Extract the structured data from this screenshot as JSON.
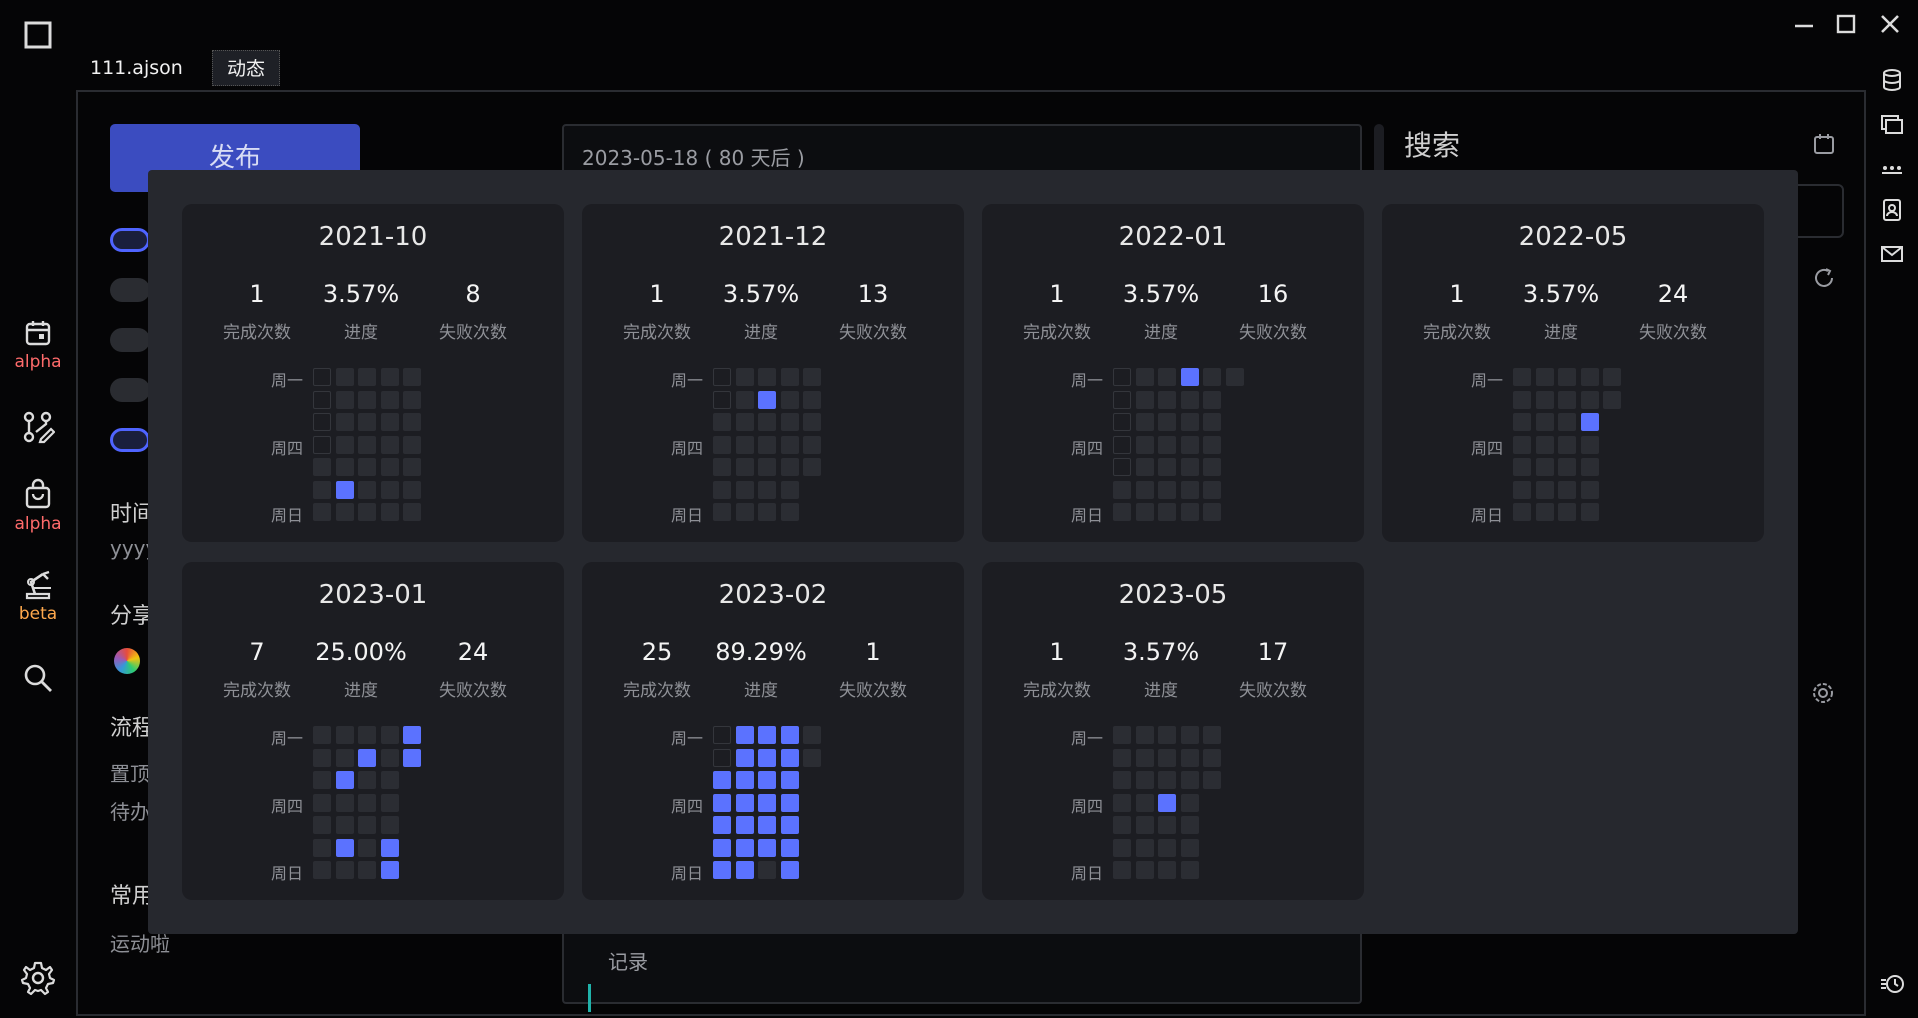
{
  "tabs": [
    {
      "label": "111.ajson",
      "active": false
    },
    {
      "label": "动态",
      "active": true
    }
  ],
  "left_rail": [
    {
      "icon": "calendar-icon",
      "label": "alpha",
      "color": "#ff6b6b"
    },
    {
      "icon": "git-edit-icon",
      "label": "",
      "color": ""
    },
    {
      "icon": "shopping-bag-icon",
      "label": "alpha",
      "color": "#ff6b6b"
    },
    {
      "icon": "robot-arm-icon",
      "label": "beta",
      "color": "#ffa94d"
    },
    {
      "icon": "search-icon",
      "label": "",
      "color": ""
    },
    {
      "icon": "gear-icon",
      "label": "",
      "color": ""
    }
  ],
  "background": {
    "publish_button": "发布",
    "date_field": "2023-05-18 ( 80 天后 )",
    "search_title": "搜索",
    "section_time": "时间",
    "time_format": "yyyy",
    "section_share": "分享",
    "section_flow": "流程",
    "flow_top": "置顶",
    "flow_todo": "待办",
    "section_common": "常用",
    "common_item": "运动啦",
    "record_text": "记录"
  },
  "accent": "#5b72ff",
  "weekday_labels": [
    "周一",
    "周四",
    "周日"
  ],
  "stat_labels": [
    "完成次数",
    "进度",
    "失败次数"
  ],
  "months": [
    {
      "title": "2021-10",
      "done": "1",
      "progress": "3.57%",
      "failed": "8",
      "grid": [
        [
          0,
          1,
          1,
          1,
          1
        ],
        [
          0,
          1,
          1,
          1,
          1
        ],
        [
          0,
          1,
          1,
          1,
          1
        ],
        [
          0,
          1,
          1,
          1,
          1
        ],
        [
          1,
          1,
          1,
          1,
          1
        ],
        [
          1,
          2,
          1,
          1,
          1
        ],
        [
          1,
          1,
          1,
          1,
          1
        ]
      ]
    },
    {
      "title": "2021-12",
      "done": "1",
      "progress": "3.57%",
      "failed": "13",
      "grid": [
        [
          0,
          1,
          1,
          1,
          1
        ],
        [
          0,
          1,
          2,
          1,
          1
        ],
        [
          1,
          1,
          1,
          1,
          1
        ],
        [
          1,
          1,
          1,
          1,
          1
        ],
        [
          1,
          1,
          1,
          1,
          1
        ],
        [
          1,
          1,
          1,
          1,
          -1
        ],
        [
          1,
          1,
          1,
          1,
          -1
        ]
      ]
    },
    {
      "title": "2022-01",
      "done": "1",
      "progress": "3.57%",
      "failed": "16",
      "grid": [
        [
          0,
          1,
          1,
          2,
          1,
          1
        ],
        [
          0,
          1,
          1,
          1,
          1,
          -1
        ],
        [
          0,
          1,
          1,
          1,
          1,
          -1
        ],
        [
          0,
          1,
          1,
          1,
          1,
          -1
        ],
        [
          0,
          1,
          1,
          1,
          1,
          -1
        ],
        [
          1,
          1,
          1,
          1,
          1,
          -1
        ],
        [
          1,
          1,
          1,
          1,
          1,
          -1
        ]
      ]
    },
    {
      "title": "2022-05",
      "done": "1",
      "progress": "3.57%",
      "failed": "24",
      "grid": [
        [
          1,
          1,
          1,
          1,
          1
        ],
        [
          1,
          1,
          1,
          1,
          1
        ],
        [
          1,
          1,
          1,
          2,
          -1
        ],
        [
          1,
          1,
          1,
          1,
          -1
        ],
        [
          1,
          1,
          1,
          1,
          -1
        ],
        [
          1,
          1,
          1,
          1,
          -1
        ],
        [
          1,
          1,
          1,
          1,
          -1
        ]
      ]
    },
    {
      "title": "2023-01",
      "done": "7",
      "progress": "25.00%",
      "failed": "24",
      "grid": [
        [
          1,
          1,
          1,
          1,
          2
        ],
        [
          1,
          1,
          2,
          1,
          2
        ],
        [
          1,
          2,
          1,
          1,
          -1
        ],
        [
          1,
          1,
          1,
          1,
          -1
        ],
        [
          1,
          1,
          1,
          1,
          -1
        ],
        [
          1,
          2,
          1,
          2,
          -1
        ],
        [
          1,
          1,
          1,
          2,
          -1
        ]
      ]
    },
    {
      "title": "2023-02",
      "done": "25",
      "progress": "89.29%",
      "failed": "1",
      "grid": [
        [
          0,
          2,
          2,
          2,
          1
        ],
        [
          0,
          2,
          2,
          2,
          1
        ],
        [
          2,
          2,
          2,
          2,
          -1
        ],
        [
          2,
          2,
          2,
          2,
          -1
        ],
        [
          2,
          2,
          2,
          2,
          -1
        ],
        [
          2,
          2,
          2,
          2,
          -1
        ],
        [
          2,
          2,
          1,
          2,
          -1
        ]
      ]
    },
    {
      "title": "2023-05",
      "done": "1",
      "progress": "3.57%",
      "failed": "17",
      "grid": [
        [
          1,
          1,
          1,
          1,
          1
        ],
        [
          1,
          1,
          1,
          1,
          1
        ],
        [
          1,
          1,
          1,
          1,
          1
        ],
        [
          1,
          1,
          2,
          1,
          -1
        ],
        [
          1,
          1,
          1,
          1,
          -1
        ],
        [
          1,
          1,
          1,
          1,
          -1
        ],
        [
          1,
          1,
          1,
          1,
          -1
        ]
      ]
    }
  ]
}
